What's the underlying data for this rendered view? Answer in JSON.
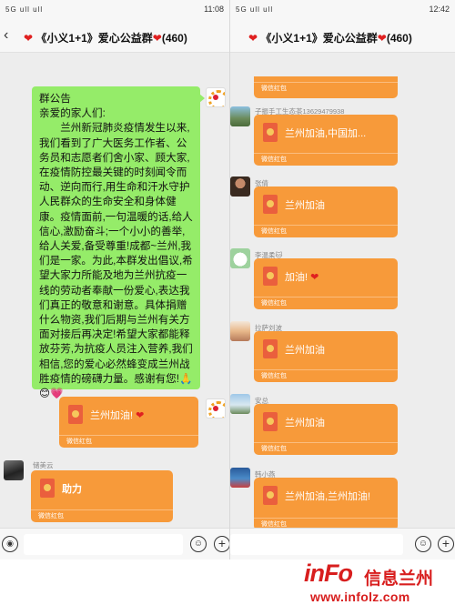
{
  "left": {
    "status": {
      "signal": "5G ull ull",
      "time": "11:08",
      "battery": "▭"
    },
    "nav": {
      "back": "‹",
      "title": "《小义1+1》爱心公益群",
      "count": "(460)",
      "more": "···"
    },
    "announcement": {
      "title": "群公告",
      "greeting": "亲爱的家人们:",
      "body": "兰州新冠肺炎疫情发生以来,我们看到了广大医务工作者、公务员和志愿者们舍小家、顾大家,在疫情防控最关键的时刻闻令而动、逆向而行,用生命和汗水守护人民群众的生命安全和身体健康。疫情面前,一句温暖的话,给人信心,激励奋斗;一个小小的善举,给人关爱,备受尊重!成都~兰州,我们是一家。为此,本群发出倡议,希望大家力所能及地为兰州抗疫一线的劳动者奉献一份爱心,表达我们真正的敬意和谢意。具体捐赠什么物资,我们后期与兰州有关方面对接后再决定!希望大家都能释放芬芳,为抗疫人员注入营养,我们相信,您的爱心必然蜂变成兰州战胜疫情的磅礴力量。感谢有您!🙏😊💗"
    },
    "packet1": {
      "text": "兰州加油!",
      "footer": "微信红包"
    },
    "packet2": {
      "sender": "储美云",
      "text": "助力",
      "footer": "微信红包"
    }
  },
  "right": {
    "status": {
      "signal": "5G ull ull",
      "time": "12:42",
      "battery": "▭"
    },
    "nav": {
      "back": "‹",
      "title": "《小义1+1》爱心公益群",
      "count": "(460)",
      "more": "···"
    },
    "top_footer": "微信红包",
    "messages": [
      {
        "sender": "子振手工生态茶13629479938",
        "text": "兰州加油,中国加...",
        "footer": "微信红包"
      },
      {
        "sender": "张倩",
        "text": "兰州加油",
        "footer": "微信红包"
      },
      {
        "sender": "李温柔🐱",
        "text": "加油!",
        "footer": "微信红包"
      },
      {
        "sender": "拉萨刘波",
        "text": "兰州加油",
        "footer": "微信红包"
      },
      {
        "sender": "安总",
        "text": "兰州加油",
        "footer": "微信红包"
      },
      {
        "sender": "韩小燕",
        "text": "兰州加油,兰州加油!",
        "footer": "微信红包"
      }
    ]
  },
  "watermark": {
    "logo": "inFo",
    "name": "信息兰州",
    "url": "www.infolz.com"
  },
  "colors": {
    "chat_bg": "#ededed",
    "green_bubble": "#95ec69",
    "red_packet": "#f79a3a",
    "brand_red": "#d81e1e"
  }
}
